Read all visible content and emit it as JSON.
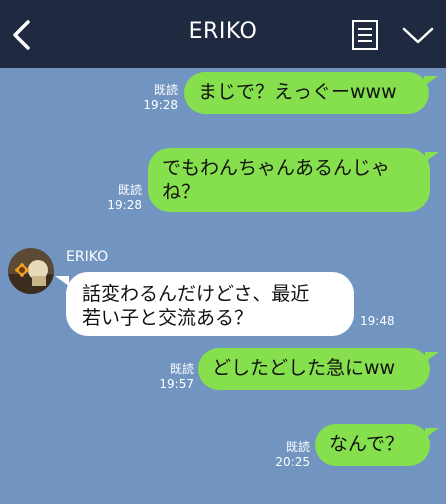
{
  "header": {
    "title": "ERIKO",
    "back_icon": "chevron-left-icon",
    "notes_icon": "notes-icon",
    "menu_icon": "chevron-down-icon"
  },
  "colors": {
    "header_bg": "#1f2a40",
    "chat_bg": "#7194c1",
    "my_bubble": "#86e04e",
    "their_bubble": "#ffffff"
  },
  "messages": [
    {
      "side": "me",
      "read": "既読",
      "time": "19:28",
      "lines": [
        "まじで？えっぐーwww"
      ]
    },
    {
      "side": "me",
      "read": "既読",
      "time": "19:28",
      "lines": [
        "でもわんちゃんあるんじゃ",
        "ね？"
      ]
    },
    {
      "side": "them",
      "sender": "ERIKO",
      "time": "19:48",
      "lines": [
        "話変わるんだけどさ、最近",
        "若い子と交流ある？"
      ]
    },
    {
      "side": "me",
      "read": "既読",
      "time": "19:57",
      "lines": [
        "どしたどした急にww"
      ]
    },
    {
      "side": "me",
      "read": "既読",
      "time": "20:25",
      "lines": [
        "なんで？"
      ]
    }
  ]
}
